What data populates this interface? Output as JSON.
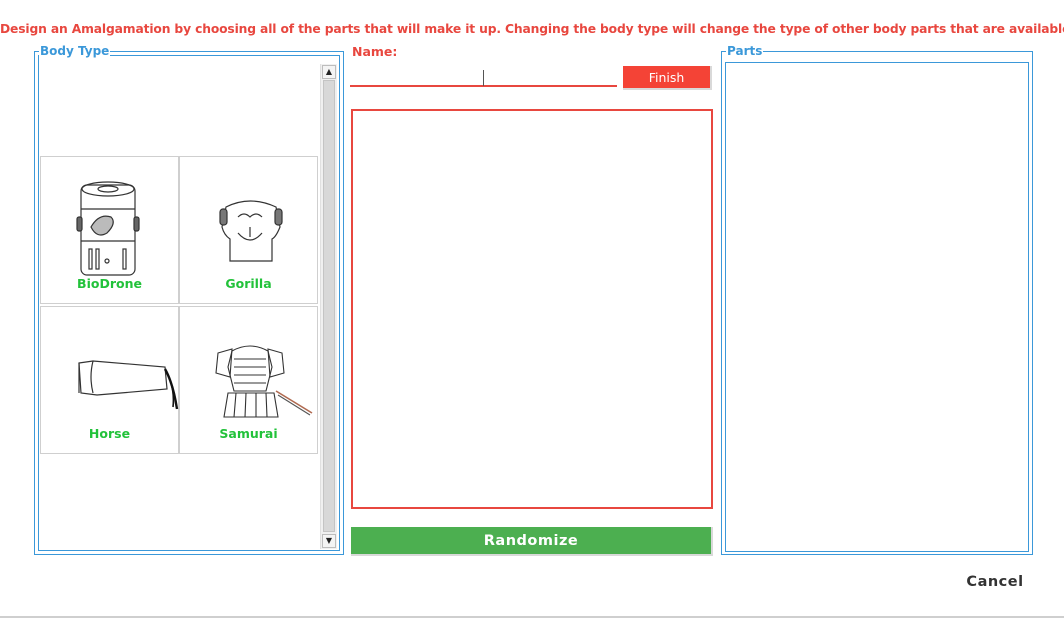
{
  "instruction": "Design an Amalgamation by choosing all of the parts that will make it up. Changing the body type will change the type of other body parts that are available.",
  "body_type": {
    "legend": "Body Type",
    "items": [
      {
        "label": "BioDrone",
        "icon": "biodrone-icon"
      },
      {
        "label": "Gorilla",
        "icon": "gorilla-icon"
      },
      {
        "label": "Horse",
        "icon": "horse-icon"
      },
      {
        "label": "Samurai",
        "icon": "samurai-icon"
      }
    ],
    "scroll_up": "▲",
    "scroll_down": "▼"
  },
  "name": {
    "label": "Name:",
    "value": "",
    "placeholder": ""
  },
  "finish_label": "Finish",
  "randomize_label": "Randomize",
  "parts": {
    "legend": "Parts"
  },
  "cancel_label": "Cancel",
  "colors": {
    "accent_red": "#e8473f",
    "finish_red": "#f44336",
    "accent_blue": "#3b98d9",
    "label_green": "#22c23a",
    "randomize_green": "#4caf50"
  }
}
